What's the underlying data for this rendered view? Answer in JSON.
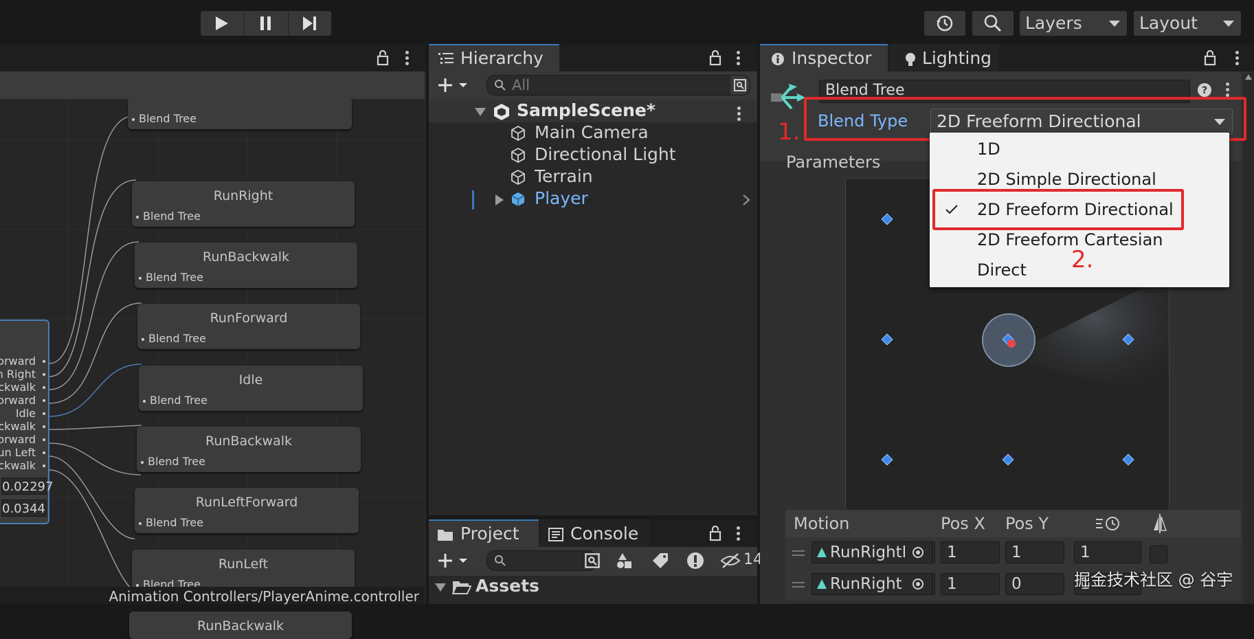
{
  "toolbar": {
    "layers_label": "Layers",
    "layout_label": "Layout"
  },
  "animator": {
    "breadcrumb": "",
    "status_path": "Animation Controllers/PlayerAnime.controller",
    "nodes": [
      {
        "title": "",
        "subtitle": "Blend Tree"
      },
      {
        "title": "RunRight",
        "subtitle": "Blend Tree"
      },
      {
        "title": "RunBackwalk",
        "subtitle": "Blend Tree"
      },
      {
        "title": "RunForward",
        "subtitle": "Blend Tree"
      },
      {
        "title": "Idle",
        "subtitle": "Blend Tree"
      },
      {
        "title": "RunBackwalk",
        "subtitle": "Blend Tree"
      },
      {
        "title": "RunLeftForward",
        "subtitle": "Blend Tree"
      },
      {
        "title": "RunLeft",
        "subtitle": "Blend Tree"
      },
      {
        "title": "RunBackwalk",
        "subtitle": ""
      }
    ],
    "param_list": [
      "orward",
      "n Right",
      "ckwalk",
      "orward",
      "Idle",
      "ckwalk",
      "orward",
      "un Left",
      "ckwalk"
    ],
    "param_values": [
      "0.02297",
      "0.0344"
    ]
  },
  "hierarchy": {
    "tab_label": "Hierarchy",
    "search_placeholder": "All",
    "scene_name": "SampleScene*",
    "items": [
      "Main Camera",
      "Directional Light",
      "Terrain",
      "Player"
    ]
  },
  "project": {
    "tab_project": "Project",
    "tab_console": "Console",
    "hidden_count": "14",
    "assets_label": "Assets"
  },
  "inspector": {
    "tab_inspector": "Inspector",
    "tab_lighting": "Lighting",
    "name_value": "Blend Tree",
    "blend_type_label": "Blend Type",
    "blend_type_value": "2D Freeform Directional",
    "parameters_label": "Parameters",
    "blend_type_options": [
      "1D",
      "2D Simple Directional",
      "2D Freeform Directional",
      "2D Freeform Cartesian",
      "Direct"
    ],
    "selected_option": "2D Freeform Directional",
    "annotation_1": "1.",
    "annotation_2": "2.",
    "motion_headers": {
      "motion": "Motion",
      "pos_x": "Pos X",
      "pos_y": "Pos Y"
    },
    "motions": [
      {
        "name": "RunRightFor",
        "pos_x": "1",
        "pos_y": "1",
        "speed": "1"
      },
      {
        "name": "RunRight",
        "pos_x": "1",
        "pos_y": "0",
        "speed": "1"
      }
    ]
  },
  "watermark": "掘金技术社区 @ 谷宇",
  "colors": {
    "accent_blue": "#3a79bb",
    "annotation_red": "#e12a2a",
    "selection_text": "#7cb6ff"
  }
}
